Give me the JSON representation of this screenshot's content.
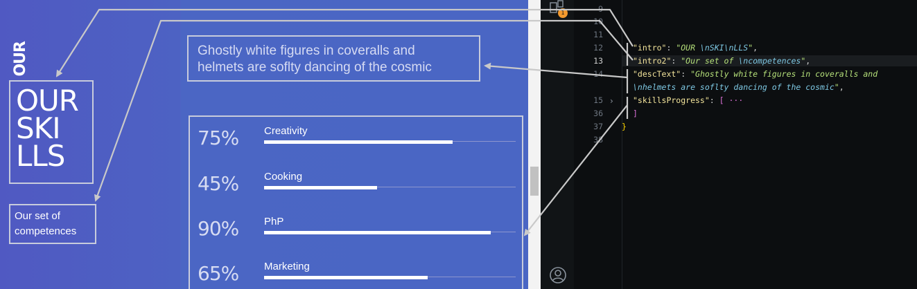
{
  "preview": {
    "logo_text": "OUR",
    "title": "OUR\nSKI\nLLS",
    "subtitle": "Our set of\ncompetences",
    "description": "Ghostly white figures in coveralls and\nhelmets are soflty dancing of the cosmic",
    "skills": [
      {
        "percent_label": "75%",
        "name": "Creativity",
        "value": 0.75
      },
      {
        "percent_label": "45%",
        "name": "Cooking",
        "value": 0.45
      },
      {
        "percent_label": "90%",
        "name": "PhP",
        "value": 0.9
      },
      {
        "percent_label": "65%",
        "name": "Marketing",
        "value": 0.65
      }
    ]
  },
  "editor": {
    "badge_count": "1",
    "line_numbers": [
      "9",
      "10",
      "11",
      "12",
      "13",
      "14",
      "",
      "15",
      "36",
      "37",
      "38"
    ],
    "active_line": "13",
    "code": {
      "intro_key": "\"intro\"",
      "intro_value_1": "\"OUR ",
      "intro_esc_1": "\\nSKI",
      "intro_esc_2": "\\nLLS",
      "intro_value_end": "\"",
      "intro2_key": "\"intro2\"",
      "intro2_value_1": "\"Our set of ",
      "intro2_esc": "\\ncompetences",
      "intro2_value_end": "\"",
      "desc_key": "\"descText\"",
      "desc_value_1": "\"Ghostly white figures in coveralls and",
      "desc_esc": "\\nhelmets are soflty dancing of the cosmic",
      "desc_value_end": "\"",
      "skills_key": "\"skillsProgress\"",
      "skills_collapsed": "[ ···",
      "close_bracket": "]",
      "close_brace": "}"
    }
  },
  "colors": {
    "accent_badge": "#f2992e",
    "preview_bg": "#4b63c4"
  },
  "icons": [
    "files-icon",
    "account-icon",
    "chevron-right-icon"
  ]
}
